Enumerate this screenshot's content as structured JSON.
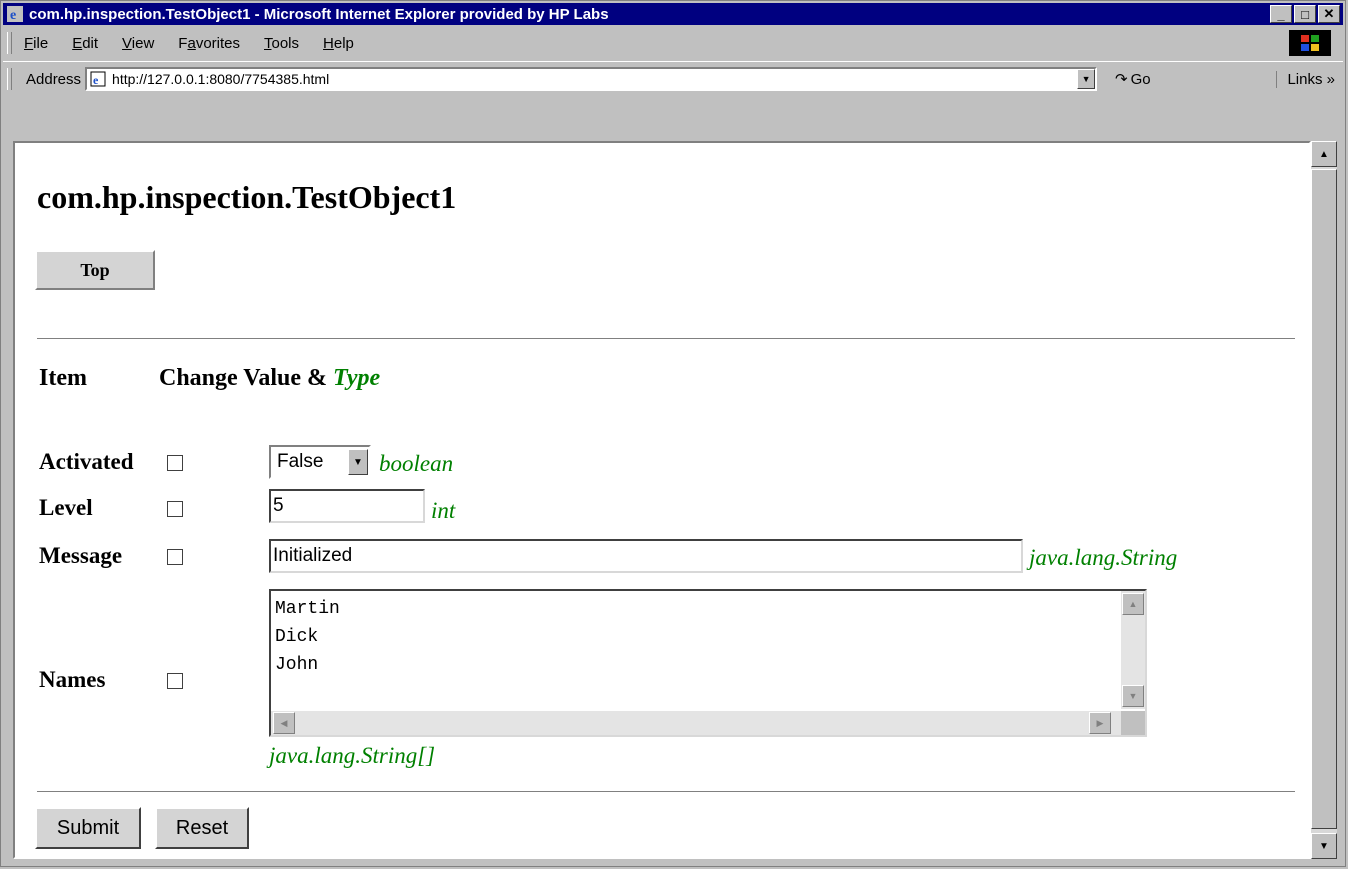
{
  "window": {
    "title": "com.hp.inspection.TestObject1 - Microsoft Internet Explorer provided by HP Labs",
    "minimize": "_",
    "maximize": "□",
    "close": "✕"
  },
  "menu": {
    "file_u": "F",
    "file_rest": "ile",
    "edit_u": "E",
    "edit_rest": "dit",
    "view_u": "V",
    "view_rest": "iew",
    "fav_pre": "F",
    "fav_u": "a",
    "fav_rest": "vorites",
    "tools_u": "T",
    "tools_rest": "ools",
    "help_u": "H",
    "help_rest": "elp"
  },
  "address": {
    "label": "Address",
    "url": "http://127.0.0.1:8080/7754385.html",
    "go": "Go",
    "links": "Links »"
  },
  "page": {
    "heading": "com.hp.inspection.TestObject1",
    "top_button": "Top",
    "col_item": "Item",
    "col_change": "Change Value &",
    "col_type": "Type",
    "fields": {
      "activated": {
        "label": "Activated",
        "value": "False",
        "type": "boolean",
        "checked": false
      },
      "level": {
        "label": "Level",
        "value": "5",
        "type": "int",
        "checked": false
      },
      "message": {
        "label": "Message",
        "value": "Initialized",
        "type": "java.lang.String",
        "checked": false
      },
      "names": {
        "label": "Names",
        "value": "Martin\nDick\nJohn",
        "type": "java.lang.String[]",
        "checked": false
      }
    },
    "submit": "Submit",
    "reset": "Reset"
  },
  "colors": {
    "titlebar": "#000080",
    "type_text": "#008000"
  }
}
